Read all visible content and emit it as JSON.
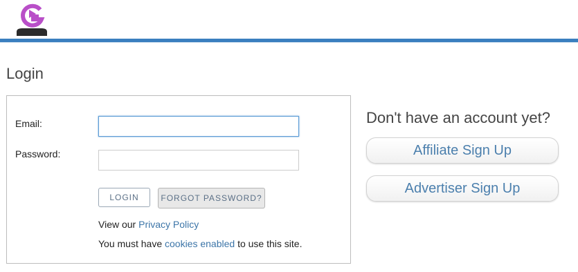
{
  "header": {
    "logo_icon": "brand-logo-icon",
    "brand_color": "#b94fc8",
    "bar_color": "#3a7fbf"
  },
  "page": {
    "title": "Login"
  },
  "login_form": {
    "email_label": "Email:",
    "email_value": "",
    "password_label": "Password:",
    "password_value": "",
    "login_button": "LOGIN",
    "forgot_button": "FORGOT PASSWORD?",
    "privacy_prefix": "View our ",
    "privacy_link": "Privacy Policy",
    "cookies_prefix": "You must have ",
    "cookies_link": "cookies enabled",
    "cookies_suffix": " to use this site."
  },
  "signup": {
    "heading": "Don't have an account yet?",
    "affiliate_button": "Affiliate Sign Up",
    "advertiser_button": "Advertiser Sign Up"
  }
}
